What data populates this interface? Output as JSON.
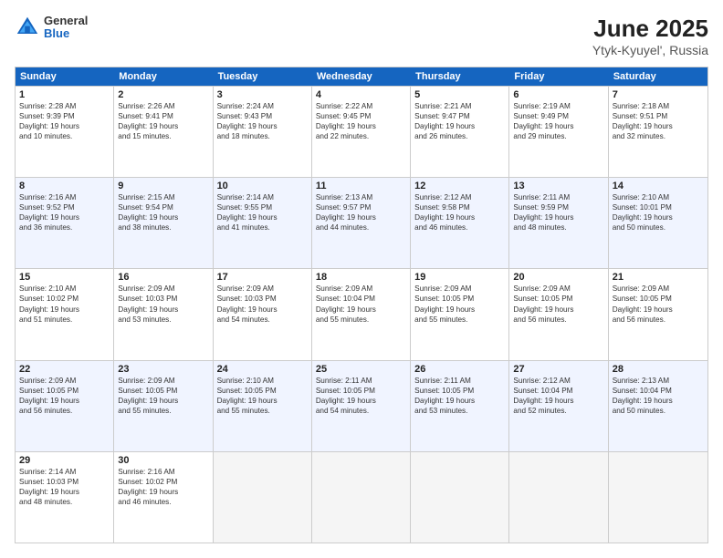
{
  "header": {
    "logo": {
      "general": "General",
      "blue": "Blue"
    },
    "title": "June 2025",
    "location": "Ytyk-Kyuyel', Russia"
  },
  "days_of_week": [
    "Sunday",
    "Monday",
    "Tuesday",
    "Wednesday",
    "Thursday",
    "Friday",
    "Saturday"
  ],
  "weeks": [
    [
      {
        "day": "1",
        "lines": [
          "Sunrise: 2:28 AM",
          "Sunset: 9:39 PM",
          "Daylight: 19 hours",
          "and 10 minutes."
        ]
      },
      {
        "day": "2",
        "lines": [
          "Sunrise: 2:26 AM",
          "Sunset: 9:41 PM",
          "Daylight: 19 hours",
          "and 15 minutes."
        ]
      },
      {
        "day": "3",
        "lines": [
          "Sunrise: 2:24 AM",
          "Sunset: 9:43 PM",
          "Daylight: 19 hours",
          "and 18 minutes."
        ]
      },
      {
        "day": "4",
        "lines": [
          "Sunrise: 2:22 AM",
          "Sunset: 9:45 PM",
          "Daylight: 19 hours",
          "and 22 minutes."
        ]
      },
      {
        "day": "5",
        "lines": [
          "Sunrise: 2:21 AM",
          "Sunset: 9:47 PM",
          "Daylight: 19 hours",
          "and 26 minutes."
        ]
      },
      {
        "day": "6",
        "lines": [
          "Sunrise: 2:19 AM",
          "Sunset: 9:49 PM",
          "Daylight: 19 hours",
          "and 29 minutes."
        ]
      },
      {
        "day": "7",
        "lines": [
          "Sunrise: 2:18 AM",
          "Sunset: 9:51 PM",
          "Daylight: 19 hours",
          "and 32 minutes."
        ]
      }
    ],
    [
      {
        "day": "8",
        "lines": [
          "Sunrise: 2:16 AM",
          "Sunset: 9:52 PM",
          "Daylight: 19 hours",
          "and 36 minutes."
        ]
      },
      {
        "day": "9",
        "lines": [
          "Sunrise: 2:15 AM",
          "Sunset: 9:54 PM",
          "Daylight: 19 hours",
          "and 38 minutes."
        ]
      },
      {
        "day": "10",
        "lines": [
          "Sunrise: 2:14 AM",
          "Sunset: 9:55 PM",
          "Daylight: 19 hours",
          "and 41 minutes."
        ]
      },
      {
        "day": "11",
        "lines": [
          "Sunrise: 2:13 AM",
          "Sunset: 9:57 PM",
          "Daylight: 19 hours",
          "and 44 minutes."
        ]
      },
      {
        "day": "12",
        "lines": [
          "Sunrise: 2:12 AM",
          "Sunset: 9:58 PM",
          "Daylight: 19 hours",
          "and 46 minutes."
        ]
      },
      {
        "day": "13",
        "lines": [
          "Sunrise: 2:11 AM",
          "Sunset: 9:59 PM",
          "Daylight: 19 hours",
          "and 48 minutes."
        ]
      },
      {
        "day": "14",
        "lines": [
          "Sunrise: 2:10 AM",
          "Sunset: 10:01 PM",
          "Daylight: 19 hours",
          "and 50 minutes."
        ]
      }
    ],
    [
      {
        "day": "15",
        "lines": [
          "Sunrise: 2:10 AM",
          "Sunset: 10:02 PM",
          "Daylight: 19 hours",
          "and 51 minutes."
        ]
      },
      {
        "day": "16",
        "lines": [
          "Sunrise: 2:09 AM",
          "Sunset: 10:03 PM",
          "Daylight: 19 hours",
          "and 53 minutes."
        ]
      },
      {
        "day": "17",
        "lines": [
          "Sunrise: 2:09 AM",
          "Sunset: 10:03 PM",
          "Daylight: 19 hours",
          "and 54 minutes."
        ]
      },
      {
        "day": "18",
        "lines": [
          "Sunrise: 2:09 AM",
          "Sunset: 10:04 PM",
          "Daylight: 19 hours",
          "and 55 minutes."
        ]
      },
      {
        "day": "19",
        "lines": [
          "Sunrise: 2:09 AM",
          "Sunset: 10:05 PM",
          "Daylight: 19 hours",
          "and 55 minutes."
        ]
      },
      {
        "day": "20",
        "lines": [
          "Sunrise: 2:09 AM",
          "Sunset: 10:05 PM",
          "Daylight: 19 hours",
          "and 56 minutes."
        ]
      },
      {
        "day": "21",
        "lines": [
          "Sunrise: 2:09 AM",
          "Sunset: 10:05 PM",
          "Daylight: 19 hours",
          "and 56 minutes."
        ]
      }
    ],
    [
      {
        "day": "22",
        "lines": [
          "Sunrise: 2:09 AM",
          "Sunset: 10:05 PM",
          "Daylight: 19 hours",
          "and 56 minutes."
        ]
      },
      {
        "day": "23",
        "lines": [
          "Sunrise: 2:09 AM",
          "Sunset: 10:05 PM",
          "Daylight: 19 hours",
          "and 55 minutes."
        ]
      },
      {
        "day": "24",
        "lines": [
          "Sunrise: 2:10 AM",
          "Sunset: 10:05 PM",
          "Daylight: 19 hours",
          "and 55 minutes."
        ]
      },
      {
        "day": "25",
        "lines": [
          "Sunrise: 2:11 AM",
          "Sunset: 10:05 PM",
          "Daylight: 19 hours",
          "and 54 minutes."
        ]
      },
      {
        "day": "26",
        "lines": [
          "Sunrise: 2:11 AM",
          "Sunset: 10:05 PM",
          "Daylight: 19 hours",
          "and 53 minutes."
        ]
      },
      {
        "day": "27",
        "lines": [
          "Sunrise: 2:12 AM",
          "Sunset: 10:04 PM",
          "Daylight: 19 hours",
          "and 52 minutes."
        ]
      },
      {
        "day": "28",
        "lines": [
          "Sunrise: 2:13 AM",
          "Sunset: 10:04 PM",
          "Daylight: 19 hours",
          "and 50 minutes."
        ]
      }
    ],
    [
      {
        "day": "29",
        "lines": [
          "Sunrise: 2:14 AM",
          "Sunset: 10:03 PM",
          "Daylight: 19 hours",
          "and 48 minutes."
        ]
      },
      {
        "day": "30",
        "lines": [
          "Sunrise: 2:16 AM",
          "Sunset: 10:02 PM",
          "Daylight: 19 hours",
          "and 46 minutes."
        ]
      },
      {
        "day": "",
        "lines": []
      },
      {
        "day": "",
        "lines": []
      },
      {
        "day": "",
        "lines": []
      },
      {
        "day": "",
        "lines": []
      },
      {
        "day": "",
        "lines": []
      }
    ]
  ]
}
